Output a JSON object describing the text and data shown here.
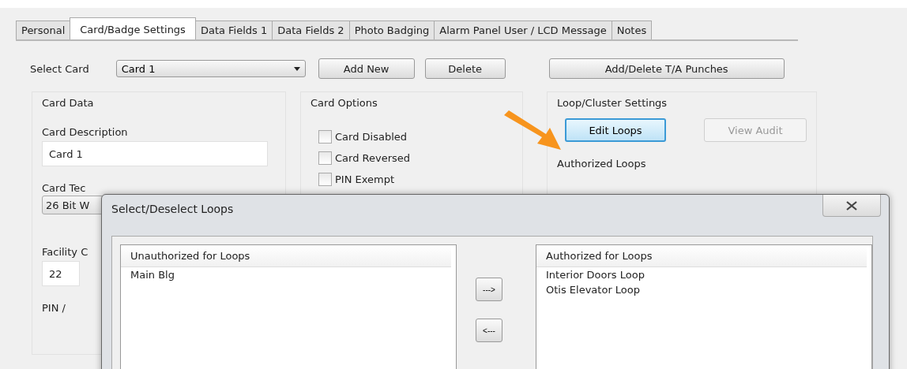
{
  "tabs": [
    {
      "label": "Personal",
      "selected": false
    },
    {
      "label": "Card/Badge Settings",
      "selected": true
    },
    {
      "label": "Data Fields 1",
      "selected": false
    },
    {
      "label": "Data Fields 2",
      "selected": false
    },
    {
      "label": "Photo Badging",
      "selected": false
    },
    {
      "label": "Alarm Panel User / LCD Message",
      "selected": false
    },
    {
      "label": "Notes",
      "selected": false
    }
  ],
  "select_card": {
    "label": "Select Card",
    "value": "Card 1"
  },
  "buttons": [
    "Add New",
    "Delete",
    "Add/Delete T/A Punches"
  ],
  "card_data": {
    "title": "Card Data",
    "description_label": "Card Description",
    "description_value": "Card 1",
    "technology_label": "Card Tec",
    "technology_value": "26 Bit W",
    "facility_label": "Facility C",
    "facility_value": "22",
    "pin_label": "PIN /"
  },
  "card_options": {
    "title": "Card Options",
    "options": [
      {
        "label": "Card Disabled",
        "checked": false
      },
      {
        "label": "Card Reversed",
        "checked": false
      },
      {
        "label": "PIN Exempt",
        "checked": false
      }
    ]
  },
  "loop_settings": {
    "title": "Loop/Cluster Settings",
    "edit_button": {
      "label": "Edit Loops",
      "focused": true
    },
    "audit_button": {
      "label": "View Audit",
      "disabled": true
    },
    "authorized_label": "Authorized Loops"
  },
  "dialog": {
    "title": "Select/Deselect Loops",
    "unauthorized": {
      "header": "Unauthorized for Loops",
      "items": [
        {
          "label": "Main Blg",
          "selected": false
        }
      ]
    },
    "move_buttons": [
      "--->",
      "<---"
    ],
    "authorized": {
      "header": "Authorized for Loops",
      "items": [
        {
          "label": "Interior Doors Loop",
          "selected": false
        },
        {
          "label": "Otis Elevator Loop",
          "selected": false
        }
      ]
    }
  }
}
